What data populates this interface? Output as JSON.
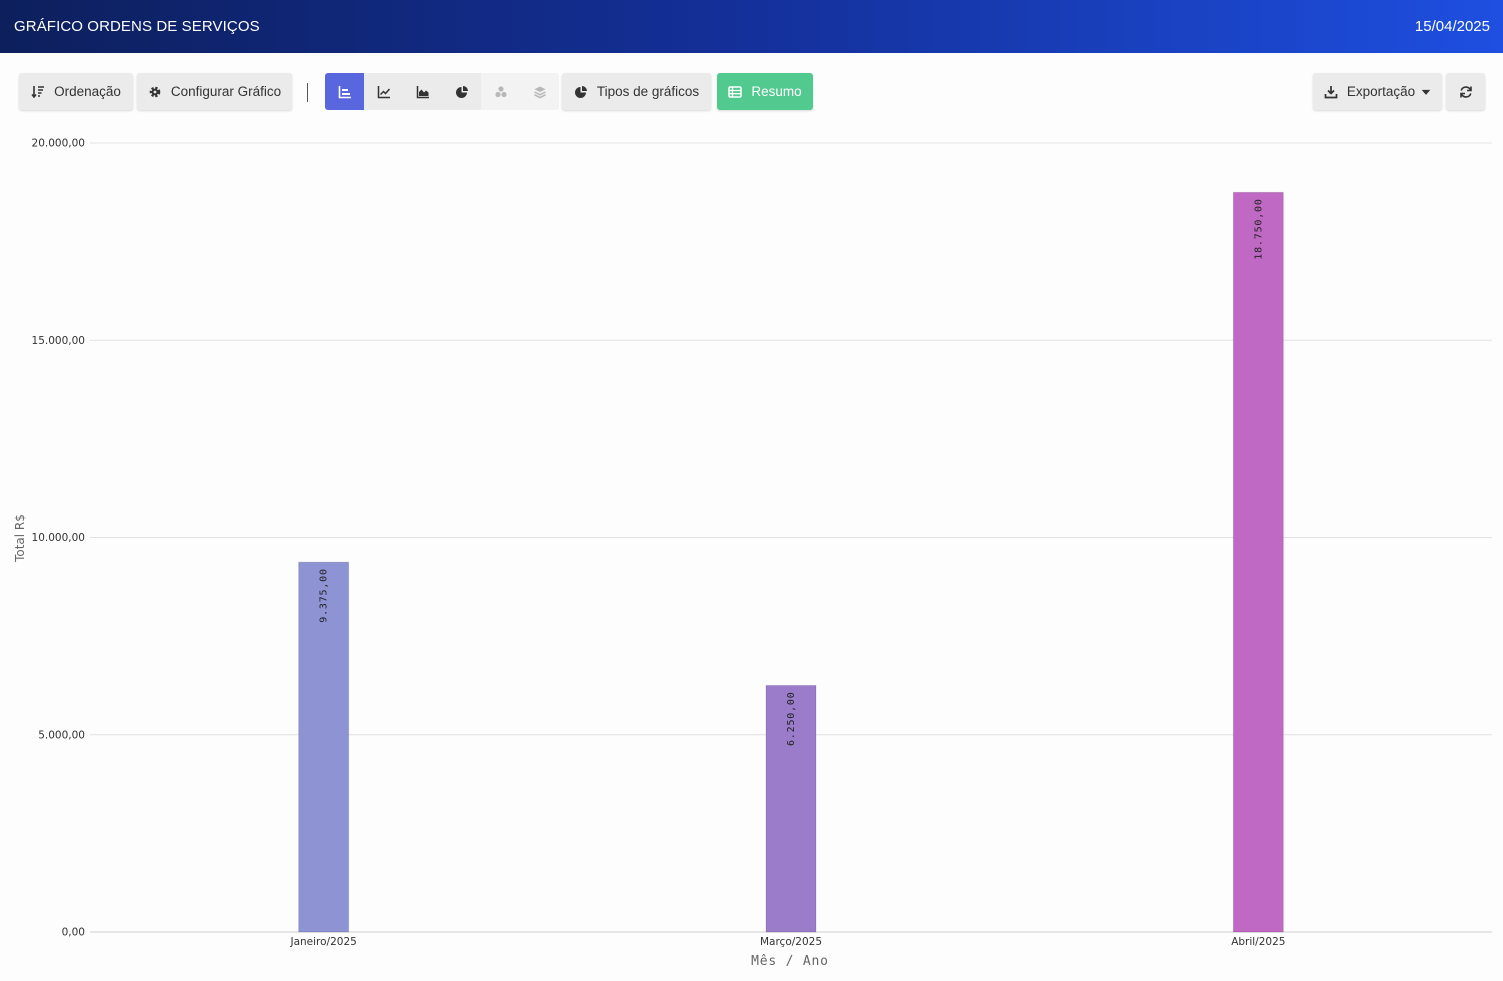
{
  "header": {
    "title": "GRÁFICO ORDENS DE SERVIÇOS",
    "date": "15/04/2025"
  },
  "toolbar": {
    "sort_label": "Ordenação",
    "config_label": "Configurar Gráfico",
    "chart_types": [
      "bar-chart-icon",
      "line-chart-icon",
      "area-chart-icon",
      "pie-chart-icon",
      "bubble-chart-icon",
      "stacked-layers-icon"
    ],
    "chart_types_label": "Tipos de gráficos",
    "summary_label": "Resumo",
    "export_label": "Exportação"
  },
  "colors": {
    "header_start": "#0d1f5c",
    "header_end": "#1e4fe0",
    "active_button": "#5867dd",
    "summary_button": "#52c98e"
  },
  "chart_data": {
    "type": "bar",
    "categories": [
      "Janeiro/2025",
      "Março/2025",
      "Abril/2025"
    ],
    "values": [
      9375,
      6250,
      18750
    ],
    "data_labels": [
      "9.375,00",
      "6.250,00",
      "18.750,00"
    ],
    "bar_colors": [
      "#8e93d4",
      "#9b7ccb",
      "#bf69c4"
    ],
    "xlabel": "Mês / Ano",
    "ylabel": "Total R$",
    "ylim": [
      0,
      20000
    ],
    "yticks": [
      0,
      5000,
      10000,
      15000,
      20000
    ],
    "ytick_labels": [
      "0,00",
      "5.000,00",
      "10.000,00",
      "15.000,00",
      "20.000,00"
    ],
    "grid": true
  }
}
